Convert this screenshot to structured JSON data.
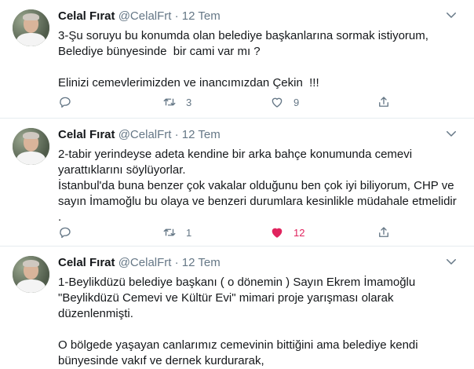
{
  "tweets": [
    {
      "name": "Celal Fırat",
      "handle": "@CelalFrt",
      "sep": "·",
      "date": "12 Tem",
      "text": "3-Şu soruyu bu konumda olan belediye başkanlarına sormak istiyorum,\nBelediye bünyesinde  bir cami var mı ?\n\nElinizi cemevlerimizden ve inancımızdan Çekin  !!!",
      "reply_count": "",
      "retweet_count": "3",
      "like_count": "9",
      "liked": false
    },
    {
      "name": "Celal Fırat",
      "handle": "@CelalFrt",
      "sep": "·",
      "date": "12 Tem",
      "text": "2-tabir yerindeyse adeta kendine bir arka bahçe konumunda cemevi yarattıklarını söylüyorlar.\nİstanbul'da buna benzer çok vakalar olduğunu ben çok iyi biliyorum, CHP ve sayın İmamoğlu bu olaya ve benzeri durumlara kesinlikle müdahale etmelidir .",
      "reply_count": "",
      "retweet_count": "1",
      "like_count": "12",
      "liked": true
    },
    {
      "name": "Celal Fırat",
      "handle": "@CelalFrt",
      "sep": "·",
      "date": "12 Tem",
      "text": "1-Beylikdüzü belediye başkanı ( o dönemin ) Sayın Ekrem İmamoğlu \"Beylikdüzü Cemevi ve Kültür Evi\" mimari proje yarışması olarak düzenlenmişti.\n\nO bölgede yaşayan canlarımız cemevinin bittiğini ama belediye kendi bünyesinde vakıf ve dernek kurdurarak,",
      "reply_count": "",
      "retweet_count": "",
      "like_count": "",
      "liked": false
    }
  ],
  "colors": {
    "muted": "#657786",
    "like": "#e0245e",
    "border": "#e6ecf0"
  },
  "icons": [
    "chevron-down-icon",
    "reply-icon",
    "retweet-icon",
    "like-icon",
    "share-icon"
  ]
}
